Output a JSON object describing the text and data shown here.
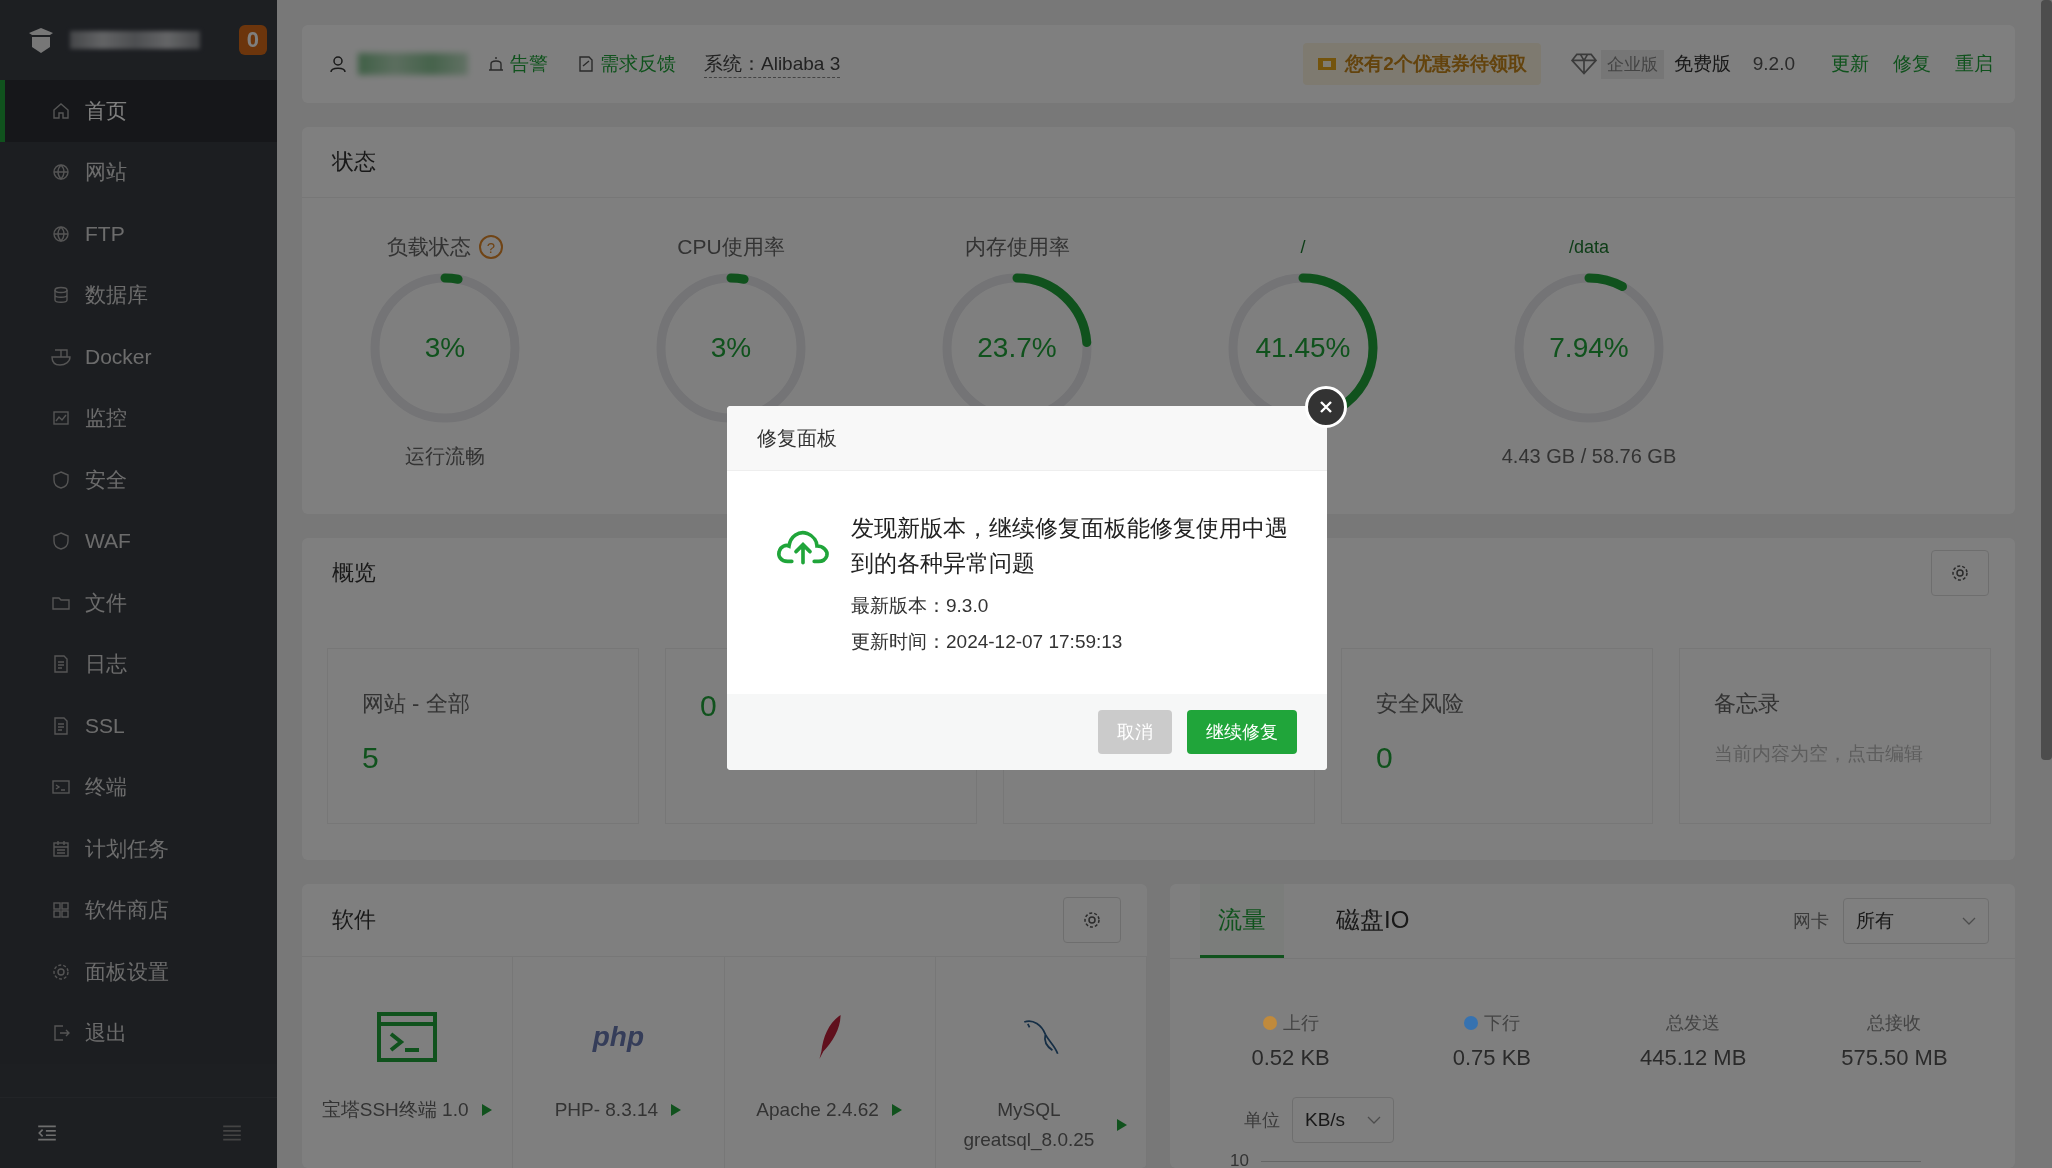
{
  "sidebar": {
    "badge": "0",
    "items": [
      {
        "label": "首页",
        "selected": true
      },
      {
        "label": "网站",
        "selected": false
      },
      {
        "label": "FTP",
        "selected": false
      },
      {
        "label": "数据库",
        "selected": false
      },
      {
        "label": "Docker",
        "selected": false
      },
      {
        "label": "监控",
        "selected": false
      },
      {
        "label": "安全",
        "selected": false
      },
      {
        "label": "WAF",
        "selected": false
      },
      {
        "label": "文件",
        "selected": false
      },
      {
        "label": "日志",
        "selected": false
      },
      {
        "label": "SSL",
        "selected": false
      },
      {
        "label": "终端",
        "selected": false
      },
      {
        "label": "计划任务",
        "selected": false
      },
      {
        "label": "软件商店",
        "selected": false
      },
      {
        "label": "面板设置",
        "selected": false
      },
      {
        "label": "退出",
        "selected": false
      }
    ]
  },
  "header": {
    "alert": "告警",
    "feedback": "需求反馈",
    "system": "系统：Alibaba 3",
    "coupon": "您有2个优惠券待领取",
    "edition_tag": "企业版",
    "edition": "免费版",
    "version": "9.2.0",
    "links": [
      "更新",
      "修复",
      "重启"
    ]
  },
  "status": {
    "title": "状态",
    "gauges": [
      {
        "kind": "metric",
        "title": "负载状态",
        "help": "?",
        "value": "3%",
        "level": 0.03,
        "reading": "运行流畅"
      },
      {
        "kind": "metric",
        "title": "CPU使用率",
        "value": "3%",
        "level": 0.03
      },
      {
        "kind": "metric",
        "title": "内存使用率",
        "value": "23.7%",
        "level": 0.237
      },
      {
        "kind": "disk",
        "title": "/",
        "value": "41.45%",
        "level": 0.4145
      },
      {
        "kind": "disk",
        "title": "/data",
        "value": "7.94%",
        "level": 0.0794,
        "reading": "4.43 GB / 58.76 GB"
      }
    ]
  },
  "overview": {
    "title": "概览",
    "cards": [
      {
        "kind": "stat",
        "title": "网站 - 全部",
        "value": "5"
      },
      {
        "kind": "stat",
        "value": "0"
      },
      {
        "kind": "stat"
      },
      {
        "kind": "stat",
        "title": "安全风险",
        "value": "0"
      },
      {
        "kind": "memo",
        "title": "备忘录",
        "placeholder": "当前内容为空，点击编辑"
      }
    ]
  },
  "software": {
    "title": "软件",
    "items": [
      {
        "kind": "terminal",
        "name": "宝塔SSH终端 1.0"
      },
      {
        "kind": "php",
        "logo_text": "php",
        "name": "PHP- 8.3.14"
      },
      {
        "kind": "apache",
        "name": "Apache 2.4.62"
      },
      {
        "kind": "mysql",
        "name": "MySQL greatsql_8.0.25"
      }
    ]
  },
  "traffic": {
    "tabs": [
      {
        "label": "流量",
        "selected": true
      },
      {
        "label": "磁盘IO",
        "selected": false
      }
    ],
    "nic_label": "网卡",
    "nic_value": "所有",
    "stats": [
      {
        "label": "上行",
        "value": "0.52 KB",
        "color": "#c08a3c"
      },
      {
        "label": "下行",
        "value": "0.75 KB",
        "color": "#3672b0"
      },
      {
        "label": "总发送",
        "value": "445.12 MB"
      },
      {
        "label": "总接收",
        "value": "575.50 MB"
      }
    ],
    "unit_label": "单位",
    "unit_value": "KB/s",
    "y_tick": "10"
  },
  "dialog": {
    "title": "修复面板",
    "message": "发现新版本，继续修复面板能修复使用中遇到的各种异常问题",
    "details": [
      "最新版本：9.3.0",
      "更新时间：2024-12-07 17:59:13"
    ],
    "buttons": [
      {
        "kind": "secondary",
        "label": "取消"
      },
      {
        "kind": "primary",
        "label": "继续修复"
      }
    ]
  }
}
